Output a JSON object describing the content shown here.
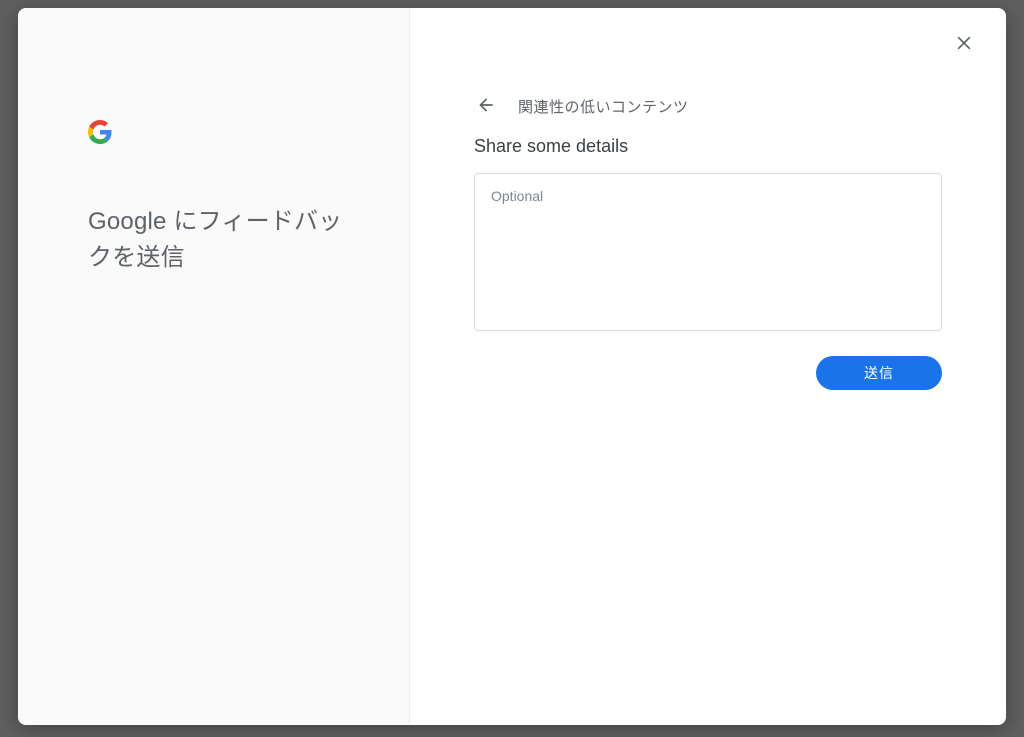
{
  "left": {
    "title": "Google にフィードバックを送信"
  },
  "right": {
    "breadcrumb": "関連性の低いコンテンツ",
    "section_title": "Share some details",
    "textarea_placeholder": "Optional",
    "textarea_value": "",
    "send_label": "送信"
  },
  "colors": {
    "accent": "#1a73e8"
  }
}
